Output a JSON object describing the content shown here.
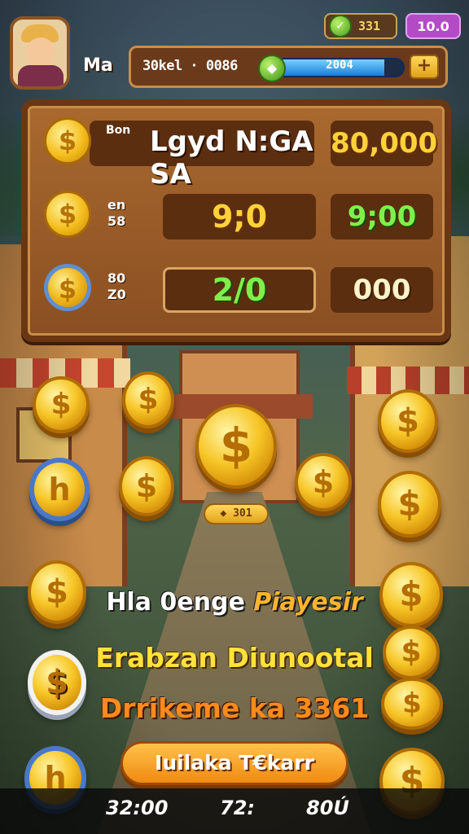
{
  "hud": {
    "gem_count": "331",
    "level": "10.0",
    "player_name": "Ma",
    "xp_text": "30kel · 0086",
    "xp_value": "2004",
    "xp_progress": 0.85,
    "plus_symbol": "+"
  },
  "board": {
    "rows": [
      {
        "small_top": "Bon",
        "small_bottom": "",
        "label": "Lgyd N:GA SA",
        "value": "80,000"
      },
      {
        "small_top": "en",
        "small_bottom": "58",
        "center": "9;0",
        "value": "9;00"
      },
      {
        "small_top": "80",
        "small_bottom": "Z0",
        "center": "2/0",
        "value": "000"
      }
    ]
  },
  "coin_symbol": "$",
  "alt_coin_symbol": "h",
  "cost_pill": "◆ 301",
  "messages": {
    "line1_white": "Hla 0enge",
    "line1_accent": "Piayesir",
    "line2": "Erabzan Diunootal",
    "line3": "Drrikeme ka 3361"
  },
  "cta_label": "Iuilaka T€kаrr",
  "bottom_stats": [
    "32:00",
    "72:",
    "80Ú"
  ],
  "colors": {
    "accent_yellow": "#ffd23a",
    "accent_green": "#7ef04a",
    "cta_orange": "#f08a12"
  }
}
